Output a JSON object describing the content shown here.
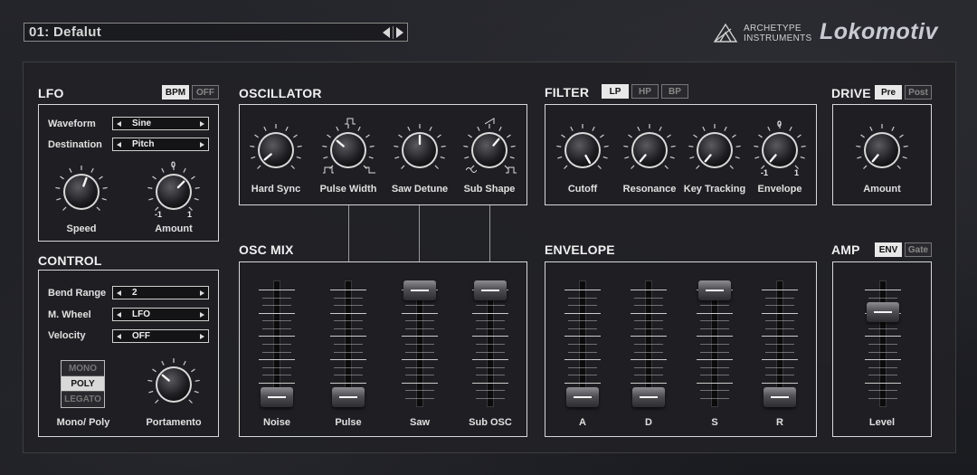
{
  "header": {
    "preset_name": "01: Defalut",
    "brand_line1": "ARCHETYPE",
    "brand_line2": "INSTRUMENTS",
    "product_name": "Lokomotiv"
  },
  "lfo": {
    "title": "LFO",
    "toggle_bpm": "BPM",
    "toggle_off": "OFF",
    "active_toggle": "BPM",
    "waveform_label": "Waveform",
    "waveform_value": "Sine",
    "destination_label": "Destination",
    "destination_value": "Pitch",
    "speed_label": "Speed",
    "amount_label": "Amount",
    "amount_top": "0",
    "amount_min": "-1",
    "amount_max": "1"
  },
  "control": {
    "title": "CONTROL",
    "bend_range_label": "Bend Range",
    "bend_range_value": "2",
    "mod_wheel_label": "M. Wheel",
    "mod_wheel_value": "LFO",
    "velocity_label": "Velocity",
    "velocity_value": "OFF",
    "mode_options": [
      "MONO",
      "POLY",
      "LEGATO"
    ],
    "mode_selected": "POLY",
    "mono_poly_label": "Mono/ Poly",
    "portamento_label": "Portamento"
  },
  "oscillator": {
    "title": "OSCILLATOR",
    "knobs": [
      "Hard Sync",
      "Pulse Width",
      "Saw Detune",
      "Sub Shape"
    ]
  },
  "osc_mix": {
    "title": "OSC MIX",
    "sliders": [
      {
        "label": "Noise",
        "value": 0.0
      },
      {
        "label": "Pulse",
        "value": 0.0
      },
      {
        "label": "Saw",
        "value": 1.0
      },
      {
        "label": "Sub OSC",
        "value": 1.0
      }
    ]
  },
  "filter": {
    "title": "FILTER",
    "modes": [
      "LP",
      "HP",
      "BP"
    ],
    "active_mode": "LP",
    "knobs": [
      "Cutoff",
      "Resonance",
      "Key Tracking",
      "Envelope"
    ],
    "env_top": "0",
    "env_min": "-1",
    "env_max": "1"
  },
  "envelope": {
    "title": "ENVELOPE",
    "sliders": [
      {
        "label": "A",
        "value": 0.0
      },
      {
        "label": "D",
        "value": 0.0
      },
      {
        "label": "S",
        "value": 1.0
      },
      {
        "label": "R",
        "value": 0.0
      }
    ]
  },
  "drive": {
    "title": "DRIVE",
    "modes": [
      "Pre",
      "Post"
    ],
    "active_mode": "Pre",
    "amount_label": "Amount"
  },
  "amp": {
    "title": "AMP",
    "modes": [
      "ENV",
      "Gate"
    ],
    "active_mode": "ENV",
    "level_label": "Level",
    "level_value": 0.8
  },
  "colors": {
    "panel_bg": "#222226",
    "box_border": "#d8d8d8",
    "active_toggle_bg": "#e8e8e8",
    "text": "#f0f0f0"
  }
}
